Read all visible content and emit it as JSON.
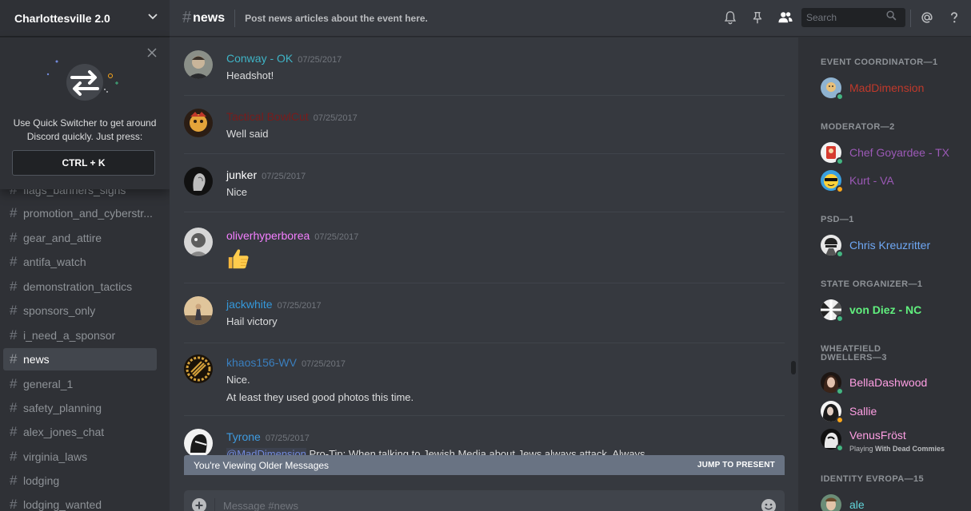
{
  "colors": {
    "conway": "#3fb4c6",
    "tactical": "#7a1b1b",
    "junker": "#ffffff",
    "oliver": "#f47fff",
    "jack": "#3498db",
    "khaos": "#3a7fbf",
    "tyrone": "#3e9be0",
    "coordinator": "#c0392b",
    "moderator": "#9b59b6",
    "psd": "#6fa8f5",
    "state": "#61f07e",
    "wheatfield": "#ff9fe4",
    "online": "#43b581",
    "idle": "#faa61a"
  },
  "sidebar": {
    "server_name": "Charlottesville 2.0",
    "quick_switcher": {
      "text": "Use Quick Switcher to get around Discord quickly. Just press:",
      "shortcut": "CTRL + K"
    },
    "channels": [
      {
        "name": "flags_banners_signs",
        "active": false
      },
      {
        "name": "promotion_and_cyberstr...",
        "active": false
      },
      {
        "name": "gear_and_attire",
        "active": false
      },
      {
        "name": "antifa_watch",
        "active": false
      },
      {
        "name": "demonstration_tactics",
        "active": false
      },
      {
        "name": "sponsors_only",
        "active": false
      },
      {
        "name": "i_need_a_sponsor",
        "active": false
      },
      {
        "name": "news",
        "active": true
      },
      {
        "name": "general_1",
        "active": false
      },
      {
        "name": "safety_planning",
        "active": false
      },
      {
        "name": "alex_jones_chat",
        "active": false
      },
      {
        "name": "virginia_laws",
        "active": false
      },
      {
        "name": "lodging",
        "active": false
      },
      {
        "name": "lodging_wanted",
        "active": false
      }
    ]
  },
  "header": {
    "hash": "#",
    "channel": "news",
    "topic": "Post news articles about the event here.",
    "search_placeholder": "Search"
  },
  "messages": [
    {
      "user": "Conway - OK",
      "time": "07/25/2017",
      "lines": [
        "Headshot!"
      ]
    },
    {
      "user": "Tactical BowlCut",
      "time": "07/25/2017",
      "lines": [
        "Well said"
      ]
    },
    {
      "user": "junker",
      "time": "07/25/2017",
      "lines": [
        "Nice"
      ]
    },
    {
      "user": "oliverhyperborea",
      "time": "07/25/2017",
      "lines": []
    },
    {
      "user": "jackwhite",
      "time": "07/25/2017",
      "lines": [
        "Hail victory"
      ]
    },
    {
      "user": "khaos156-WV",
      "time": "07/25/2017",
      "lines": [
        "Nice.",
        "At least they used good photos this time."
      ]
    },
    {
      "user": "Tyrone",
      "time": "07/25/2017",
      "mention": "@MadDimension",
      "lines": [
        " Pro-Tip: When talking to Jewish Media about Jews always attack. Always."
      ]
    }
  ],
  "older_bar": {
    "label": "You're Viewing Older Messages",
    "jump": "JUMP TO PRESENT"
  },
  "composer": {
    "placeholder": "Message #news"
  },
  "members": {
    "roles": [
      {
        "title": "EVENT COORDINATOR—1",
        "members": [
          {
            "name": "MadDimension"
          }
        ]
      },
      {
        "title": "MODERATOR—2",
        "members": [
          {
            "name": "Chef Goyardee - TX"
          },
          {
            "name": "Kurt - VA"
          }
        ]
      },
      {
        "title": "PSD—1",
        "members": [
          {
            "name": "Chris Kreuzritter"
          }
        ]
      },
      {
        "title": "STATE ORGANIZER—1",
        "members": [
          {
            "name": "von Diez - NC"
          }
        ]
      },
      {
        "title": "WHEATFIELD DWELLERS—3",
        "title_line1": "WHEATFIELD",
        "title_line2": "DWELLERS—3",
        "members": [
          {
            "name": "BellaDashwood"
          },
          {
            "name": "Sallie"
          },
          {
            "name": "VenusFröst",
            "activity_prefix": "Playing ",
            "activity": "With Dead Commies"
          }
        ]
      },
      {
        "title": "IDENTITY EVROPA—15",
        "members": [
          {
            "name": "ale"
          }
        ]
      }
    ]
  }
}
